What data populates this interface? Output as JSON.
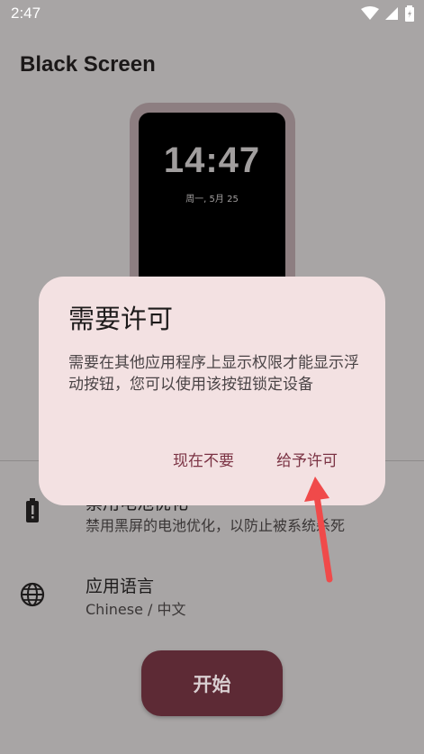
{
  "status_bar": {
    "time": "2:47",
    "icons": [
      "wifi-icon",
      "signal-icon",
      "battery-icon"
    ]
  },
  "app": {
    "title": "Black Screen"
  },
  "preview": {
    "time": "14:47",
    "date": "周一, 5月 25"
  },
  "settings": [
    {
      "title": "禁用电池优化",
      "subtitle": "禁用黑屏的电池优化，以防止被系统杀死",
      "icon": "battery-alert-icon"
    },
    {
      "title": "应用语言",
      "subtitle": "Chinese / 中文",
      "icon": "globe-icon"
    }
  ],
  "start_button": {
    "label": "开始"
  },
  "dialog": {
    "title": "需要许可",
    "body": "需要在其他应用程序上显示权限才能显示浮动按钮，您可以使用该按钮锁定设备",
    "dismiss_label": "现在不要",
    "grant_label": "给予许可"
  },
  "colors": {
    "scrim": "#a8a5a5",
    "dialog_bg": "#f3e1e2",
    "accent": "#7b3344",
    "button": "#5d2a35",
    "arrow": "#f04a4a"
  }
}
